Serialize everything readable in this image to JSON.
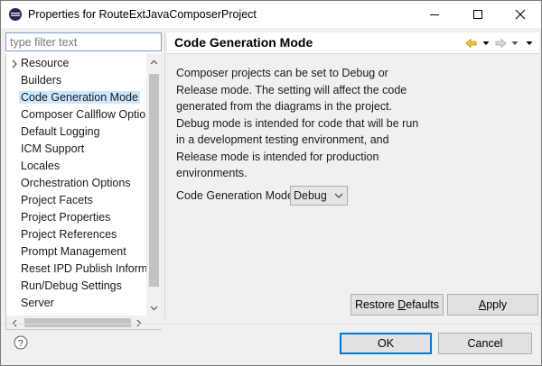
{
  "window": {
    "title": "Properties for RouteExtJavaComposerProject"
  },
  "filter": {
    "placeholder": "type filter text"
  },
  "tree": {
    "items": [
      {
        "label": "Resource",
        "expandable": true,
        "selected": false
      },
      {
        "label": "Builders",
        "expandable": false,
        "selected": false
      },
      {
        "label": "Code Generation Mode",
        "expandable": false,
        "selected": true
      },
      {
        "label": "Composer Callflow Optio",
        "expandable": false,
        "selected": false
      },
      {
        "label": "Default Logging",
        "expandable": false,
        "selected": false
      },
      {
        "label": "ICM Support",
        "expandable": false,
        "selected": false
      },
      {
        "label": "Locales",
        "expandable": false,
        "selected": false
      },
      {
        "label": "Orchestration Options",
        "expandable": false,
        "selected": false
      },
      {
        "label": "Project Facets",
        "expandable": false,
        "selected": false
      },
      {
        "label": "Project Properties",
        "expandable": false,
        "selected": false
      },
      {
        "label": "Project References",
        "expandable": false,
        "selected": false
      },
      {
        "label": "Prompt Management",
        "expandable": false,
        "selected": false
      },
      {
        "label": "Reset IPD Publish Informa",
        "expandable": false,
        "selected": false
      },
      {
        "label": "Run/Debug Settings",
        "expandable": false,
        "selected": false
      },
      {
        "label": "Server",
        "expandable": false,
        "selected": false
      }
    ]
  },
  "page": {
    "title": "Code Generation Mode",
    "description_lines": [
      "Composer projects can be set to Debug or",
      "Release mode.  The setting will affect the code",
      "generated from the diagrams in the project.",
      "Debug mode is intended for code that will be run",
      "in a development testing environment, and",
      "Release mode is intended for production",
      "environments."
    ],
    "field_label": "Code Generation Mode",
    "field_value": "Debug"
  },
  "buttons": {
    "restore_pre": "Restore ",
    "restore_mnemonic": "D",
    "restore_post": "efaults",
    "apply_mnemonic": "A",
    "apply_post": "pply",
    "ok": "OK",
    "cancel": "Cancel"
  },
  "colors": {
    "selection": "#cce8ff",
    "default_button_border": "#0078d7",
    "nav_back_arrow": "#e8a200"
  }
}
